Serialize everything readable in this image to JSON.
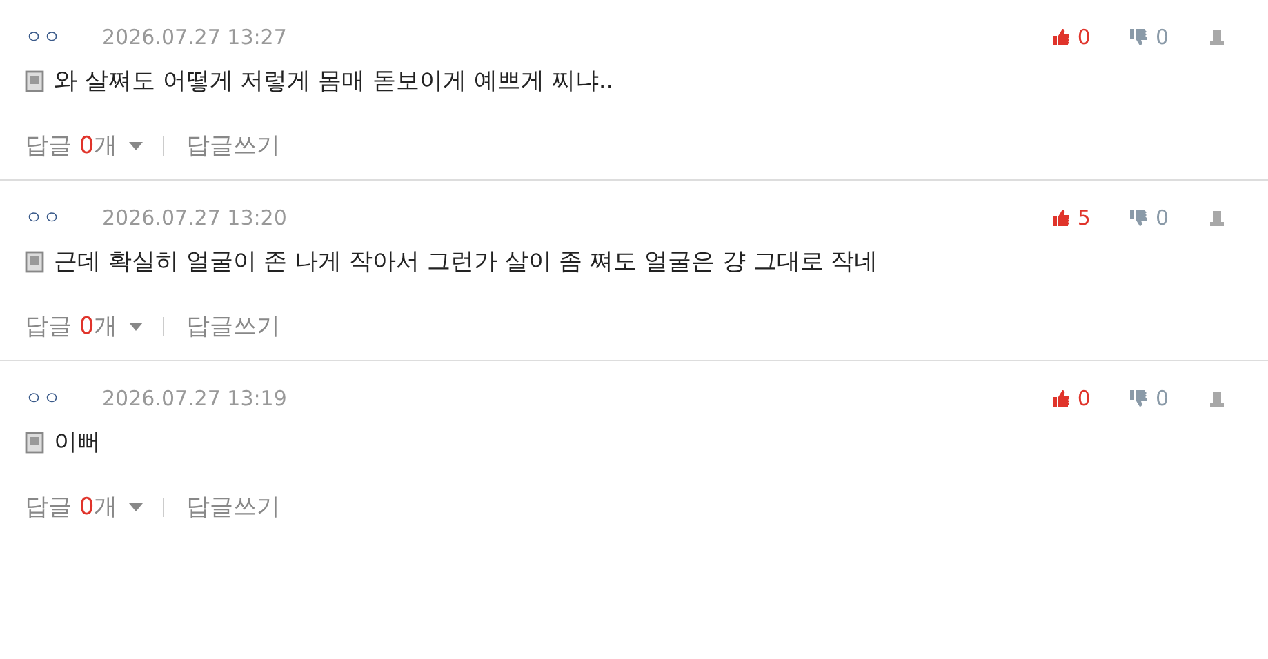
{
  "comments": [
    {
      "author": "ㅇㅇ",
      "time": "2026.07.27 13:27",
      "text": "와 살쪄도 어떻게 저렇게 몸매 돋보이게 예쁘게 찌냐..",
      "likes": "0",
      "dislikes": "0",
      "reply_label": "답글",
      "reply_count": "0",
      "reply_unit": "개",
      "write_reply": "답글쓰기"
    },
    {
      "author": "ㅇㅇ",
      "time": "2026.07.27 13:20",
      "text": "근데 확실히 얼굴이 존 나게 작아서 그런가 살이 좀 쪄도 얼굴은 걍 그대로 작네",
      "likes": "5",
      "dislikes": "0",
      "reply_label": "답글",
      "reply_count": "0",
      "reply_unit": "개",
      "write_reply": "답글쓰기"
    },
    {
      "author": "ㅇㅇ",
      "time": "2026.07.27 13:19",
      "text": "이뻐",
      "likes": "0",
      "dislikes": "0",
      "reply_label": "답글",
      "reply_count": "0",
      "reply_unit": "개",
      "write_reply": "답글쓰기"
    }
  ]
}
